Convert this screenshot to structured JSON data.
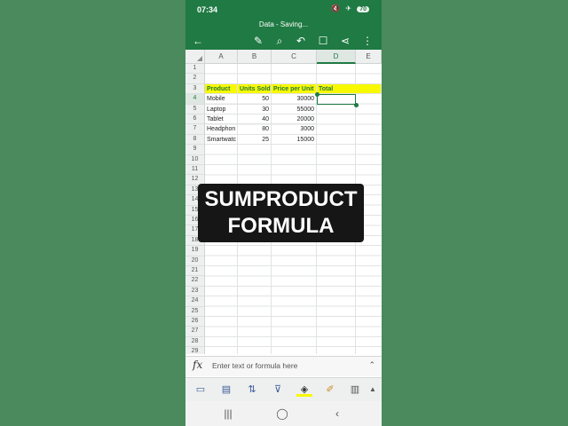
{
  "status": {
    "time": "07:34",
    "icons": "🔇 ✈",
    "battery": "70"
  },
  "title": "Data - Saving...",
  "columns": [
    "A",
    "B",
    "C",
    "D",
    "E"
  ],
  "rows": [
    "1",
    "2",
    "3",
    "4",
    "5",
    "6",
    "7",
    "8",
    "9",
    "10",
    "11",
    "12",
    "13",
    "14",
    "15",
    "16",
    "17",
    "18",
    "19",
    "20",
    "21",
    "22",
    "23",
    "24",
    "25",
    "26",
    "27",
    "28",
    "29"
  ],
  "sheet": {
    "headers": [
      "Product",
      "Units Sold",
      "Price per Unit",
      "Total"
    ],
    "data": [
      {
        "product": "Mobile",
        "units": "50",
        "price": "30000"
      },
      {
        "product": "Laptop",
        "units": "30",
        "price": "55000"
      },
      {
        "product": "Tablet",
        "units": "40",
        "price": "20000"
      },
      {
        "product": "Headphon",
        "units": "80",
        "price": "3000"
      },
      {
        "product": "Smartwatc",
        "units": "25",
        "price": "15000"
      }
    ]
  },
  "overlay": {
    "line1": "SUMPRODUCT",
    "line2": "FORMULA"
  },
  "formula_bar": {
    "fx": "fx",
    "placeholder": "Enter text or formula here"
  },
  "colors": {
    "excel_green": "#1f7a43",
    "header_fill": "#f8f800",
    "header_text": "#1f7a43",
    "background": "#4a8a5c"
  }
}
